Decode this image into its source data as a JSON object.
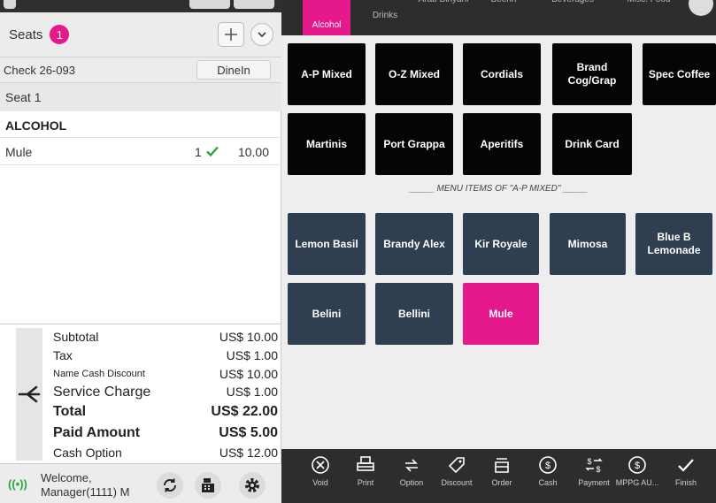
{
  "left_panel": {
    "seats": {
      "label": "Seats",
      "count": "1"
    },
    "check": {
      "label": "Check 26-093",
      "order_type": "DineIn"
    },
    "seat": "Seat 1",
    "category": "ALCOHOL",
    "items": [
      {
        "name": "Mule",
        "qty": "1",
        "price": "10.00",
        "status": "confirmed"
      }
    ],
    "totals": [
      {
        "label": "Subtotal",
        "value": "US$ 10.00",
        "style": "normal"
      },
      {
        "label": "Tax",
        "value": "US$ 1.00",
        "style": "normal"
      },
      {
        "label": "Name Cash Discount",
        "value": "US$ 10.00",
        "style": "small"
      },
      {
        "label": "Service Charge",
        "value": "US$ 1.00",
        "style": "normal"
      },
      {
        "label": "Total",
        "value": "US$ 22.00",
        "style": "bold"
      },
      {
        "label": "Paid Amount",
        "value": "US$ 5.00",
        "style": "bold"
      },
      {
        "label": "Cash Option",
        "value": "US$ 12.00",
        "style": "normal"
      }
    ],
    "status": {
      "welcome_line1": "Welcome,",
      "welcome_line2": "Manager(1111) M"
    }
  },
  "category_tabs": [
    {
      "label": "Alcohol",
      "active": true
    },
    {
      "label": "Drinks",
      "active": false
    },
    {
      "label": "Arab Biriyani",
      "active": false
    },
    {
      "label": "Beerin",
      "active": false
    },
    {
      "label": "Beverages",
      "active": false
    },
    {
      "label": "Misc. Food",
      "active": false
    }
  ],
  "subcategories": [
    "A-P Mixed",
    "O-Z Mixed",
    "Cordials",
    "Brand Cog/Grap",
    "Spec Coffee",
    "Martinis",
    "Port Grappa",
    "Aperitifs",
    "Drink Card"
  ],
  "menu_caption": "_____ MENU ITEMS OF \"A-P MIXED\" _____",
  "menu_items": [
    {
      "label": "Lemon Basil",
      "selected": false
    },
    {
      "label": "Brandy Alex",
      "selected": false
    },
    {
      "label": "Kir Royale",
      "selected": false
    },
    {
      "label": "Mimosa",
      "selected": false
    },
    {
      "label": "Blue B Lemonade",
      "selected": false
    },
    {
      "label": "Belini",
      "selected": false
    },
    {
      "label": "Bellini",
      "selected": false
    },
    {
      "label": "Mule",
      "selected": true
    }
  ],
  "toolbar": [
    {
      "label": "Void",
      "icon": "void-icon"
    },
    {
      "label": "Print",
      "icon": "print-icon"
    },
    {
      "label": "Option",
      "icon": "option-icon"
    },
    {
      "label": "Discount",
      "icon": "discount-icon"
    },
    {
      "label": "Order",
      "icon": "order-icon"
    },
    {
      "label": "Cash",
      "icon": "cash-icon"
    },
    {
      "label": "Payment",
      "icon": "payment-icon"
    },
    {
      "label": "MPPG AU...",
      "icon": "mppg-icon"
    },
    {
      "label": "Finish",
      "icon": "finish-icon"
    }
  ],
  "colors": {
    "accent": "#e5198b",
    "tile_black": "#050505",
    "tile_item": "#2f3e50",
    "bar_dark": "#2d2d2d",
    "confirm_green": "#2aa836"
  }
}
